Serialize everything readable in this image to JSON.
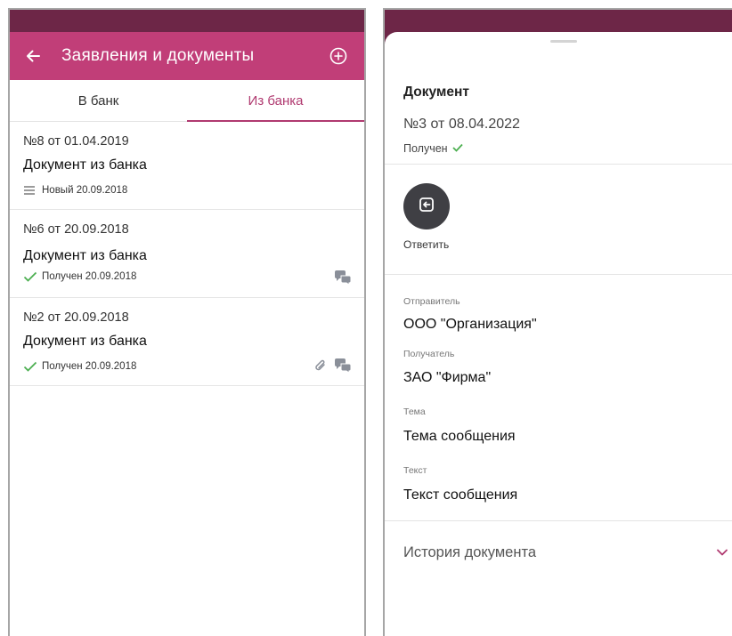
{
  "left_screen": {
    "header": {
      "title": "Заявления и документы"
    },
    "tabs": [
      {
        "label": "В банк",
        "active": false
      },
      {
        "label": "Из банка",
        "active": true
      }
    ],
    "documents": [
      {
        "number": "№8 от 01.04.2019",
        "title": "Документ из банка",
        "status": "Новый 20.09.2018",
        "status_icon": "menu-lines-icon",
        "attachment": false,
        "chat": false
      },
      {
        "number": "№6 от 20.09.2018",
        "title": "Документ из банка",
        "status": "Получен 20.09.2018",
        "status_icon": "check-icon",
        "attachment": false,
        "chat": true
      },
      {
        "number": "№2 от 20.09.2018",
        "title": "Документ из банка",
        "status": "Получен 20.09.2018",
        "status_icon": "check-icon",
        "attachment": true,
        "chat": true
      }
    ]
  },
  "right_screen": {
    "document": {
      "title": "Документ",
      "number": "№3 от 08.04.2022",
      "status": "Получен"
    },
    "reply": {
      "label": "Ответить"
    },
    "fields": {
      "sender": {
        "label": "Отправитель",
        "value": "ООО \"Организация\""
      },
      "recipient": {
        "label": "Получатель",
        "value": "ЗАО \"Фирма\""
      },
      "subject": {
        "label": "Тема",
        "value": "Тема сообщения"
      },
      "text": {
        "label": "Текст",
        "value": "Текст сообщения"
      }
    },
    "history": {
      "label": "История документа"
    }
  },
  "colors": {
    "status_bar": "#6d2647",
    "app_bar": "#c13e78",
    "accent": "#b03a70",
    "check_green": "#4caf50",
    "reply_button": "#3f3f44"
  }
}
